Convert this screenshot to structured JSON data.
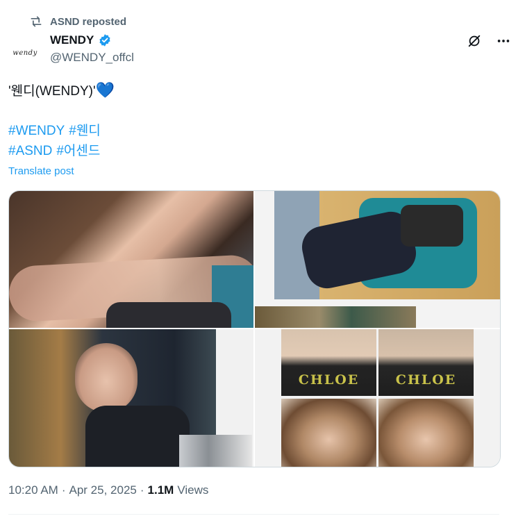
{
  "repost": {
    "label": "ASND reposted",
    "icon": "repost-icon"
  },
  "author": {
    "avatar_text": "wendy",
    "display_name": "WENDY",
    "handle": "@WENDY_offcl",
    "verified_color": "#1d9bf0"
  },
  "post": {
    "text": "'웬디(WENDY)'",
    "emoji": "💙",
    "hashtags": [
      "#WENDY",
      "#웬디",
      "#ASND",
      "#어센드"
    ],
    "translate_label": "Translate post"
  },
  "media": {
    "chloe_label": "CHLOE"
  },
  "meta": {
    "time": "10:20 AM",
    "date": "Apr 25, 2025",
    "views_count": "1.1M",
    "views_label": "Views"
  },
  "colors": {
    "accent": "#1d9bf0",
    "secondary_text": "#536471",
    "primary_text": "#0f1419"
  }
}
